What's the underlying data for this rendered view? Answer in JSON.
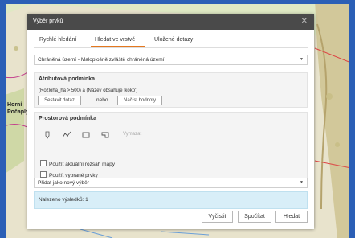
{
  "map": {
    "labels": [
      "Horní",
      "Počaply"
    ]
  },
  "dialog": {
    "title": "Výběr prvků",
    "close": "✕"
  },
  "tabs": [
    {
      "label": "Rychlé hledání",
      "active": false
    },
    {
      "label": "Hledat ve vrstvě",
      "active": true
    },
    {
      "label": "Uložené dotazy",
      "active": false
    }
  ],
  "layer_select": {
    "value": "Chráněná území - Maloplošně zvláště chráněná území"
  },
  "attribute_condition": {
    "title": "Atributová podmínka",
    "expression": "(Rozloha_ha > 500) a (Název obsahuje 'koko')",
    "build_button": "Sestavit dotaz",
    "or_text": "nebo",
    "load_button": "Načíst hodnoty"
  },
  "spatial_condition": {
    "title": "Prostorová podmínka",
    "tools": [
      "point-icon",
      "polyline-icon",
      "rectangle-icon",
      "polygon-icon"
    ],
    "clear_button": "Vymazat",
    "checkboxes": [
      {
        "label": "Použít aktuální rozsah mapy",
        "checked": false
      },
      {
        "label": "Použít vybrané prvky",
        "checked": false
      }
    ]
  },
  "mode_select": {
    "value": "Přidat jako nový výběr"
  },
  "result": {
    "text": "Nalezeno výsledků: 1"
  },
  "buttons": {
    "clear": "Vyčistit",
    "count": "Spočítat",
    "search": "Hledat"
  },
  "colors": {
    "accent": "#e4781f",
    "header": "#4a4a4a",
    "result_bg": "#d8eef8"
  }
}
